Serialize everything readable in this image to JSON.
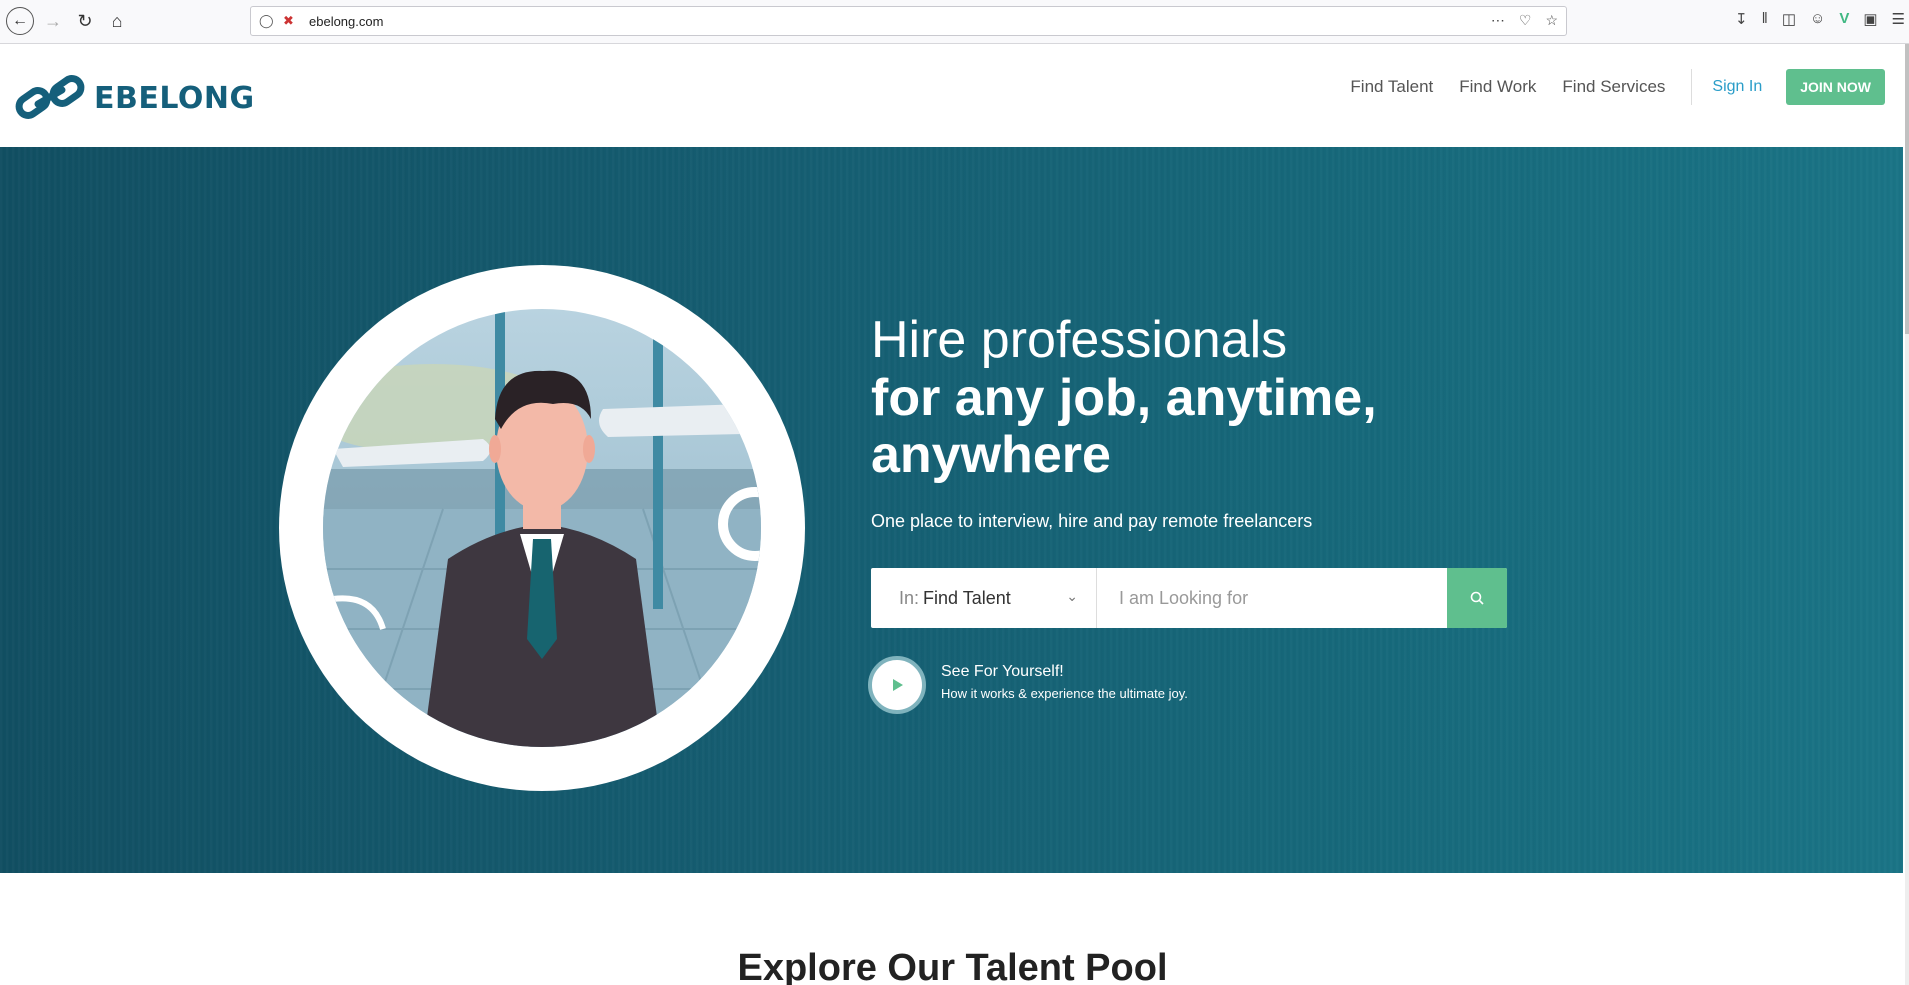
{
  "browser": {
    "url": "ebelong.com"
  },
  "header": {
    "logo_text": "EBELONG",
    "nav": [
      "Find Talent",
      "Find Work",
      "Find Services"
    ],
    "sign_in": "Sign In",
    "join": "JOIN NOW"
  },
  "hero": {
    "title_light": "Hire professionals",
    "title_bold": "for any job, anytime, anywhere",
    "subtitle": "One place to interview, hire and pay remote freelancers",
    "search": {
      "prefix": "In:",
      "selected": "Find Talent",
      "placeholder": "I am Looking for"
    },
    "video": {
      "title": "See For Yourself!",
      "subtitle": "How it works & experience the ultimate joy."
    }
  },
  "section": {
    "title": "Explore Our Talent Pool"
  },
  "colors": {
    "brand": "#155f7b",
    "accent": "#5fbf8e",
    "link": "#2a9dc8"
  }
}
